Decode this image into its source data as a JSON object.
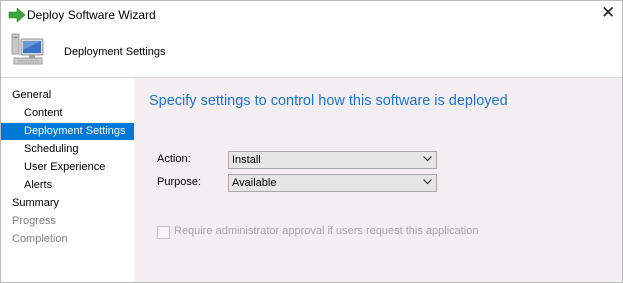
{
  "window": {
    "title": "Deploy Software Wizard"
  },
  "header": {
    "title": "Deployment Settings"
  },
  "nav": {
    "items": [
      {
        "label": "General"
      },
      {
        "label": "Content"
      },
      {
        "label": "Deployment Settings"
      },
      {
        "label": "Scheduling"
      },
      {
        "label": "User Experience"
      },
      {
        "label": "Alerts"
      },
      {
        "label": "Summary"
      },
      {
        "label": "Progress"
      },
      {
        "label": "Completion"
      }
    ],
    "active_index": 2
  },
  "main": {
    "heading": "Specify settings to control how this software is deployed",
    "action": {
      "label": "Action:",
      "value": "Install"
    },
    "purpose": {
      "label": "Purpose:",
      "value": "Available"
    },
    "approval": {
      "label": "Require administrator approval if users request this application",
      "checked": false,
      "enabled": false
    }
  },
  "colors": {
    "accent": "#0078d7",
    "heading": "#1e73c8",
    "panel": "#f2eef2",
    "disabled_text": "#808080"
  },
  "icons": [
    "green-arrow-icon",
    "computer-icon",
    "close-icon",
    "chevron-down-icon"
  ]
}
